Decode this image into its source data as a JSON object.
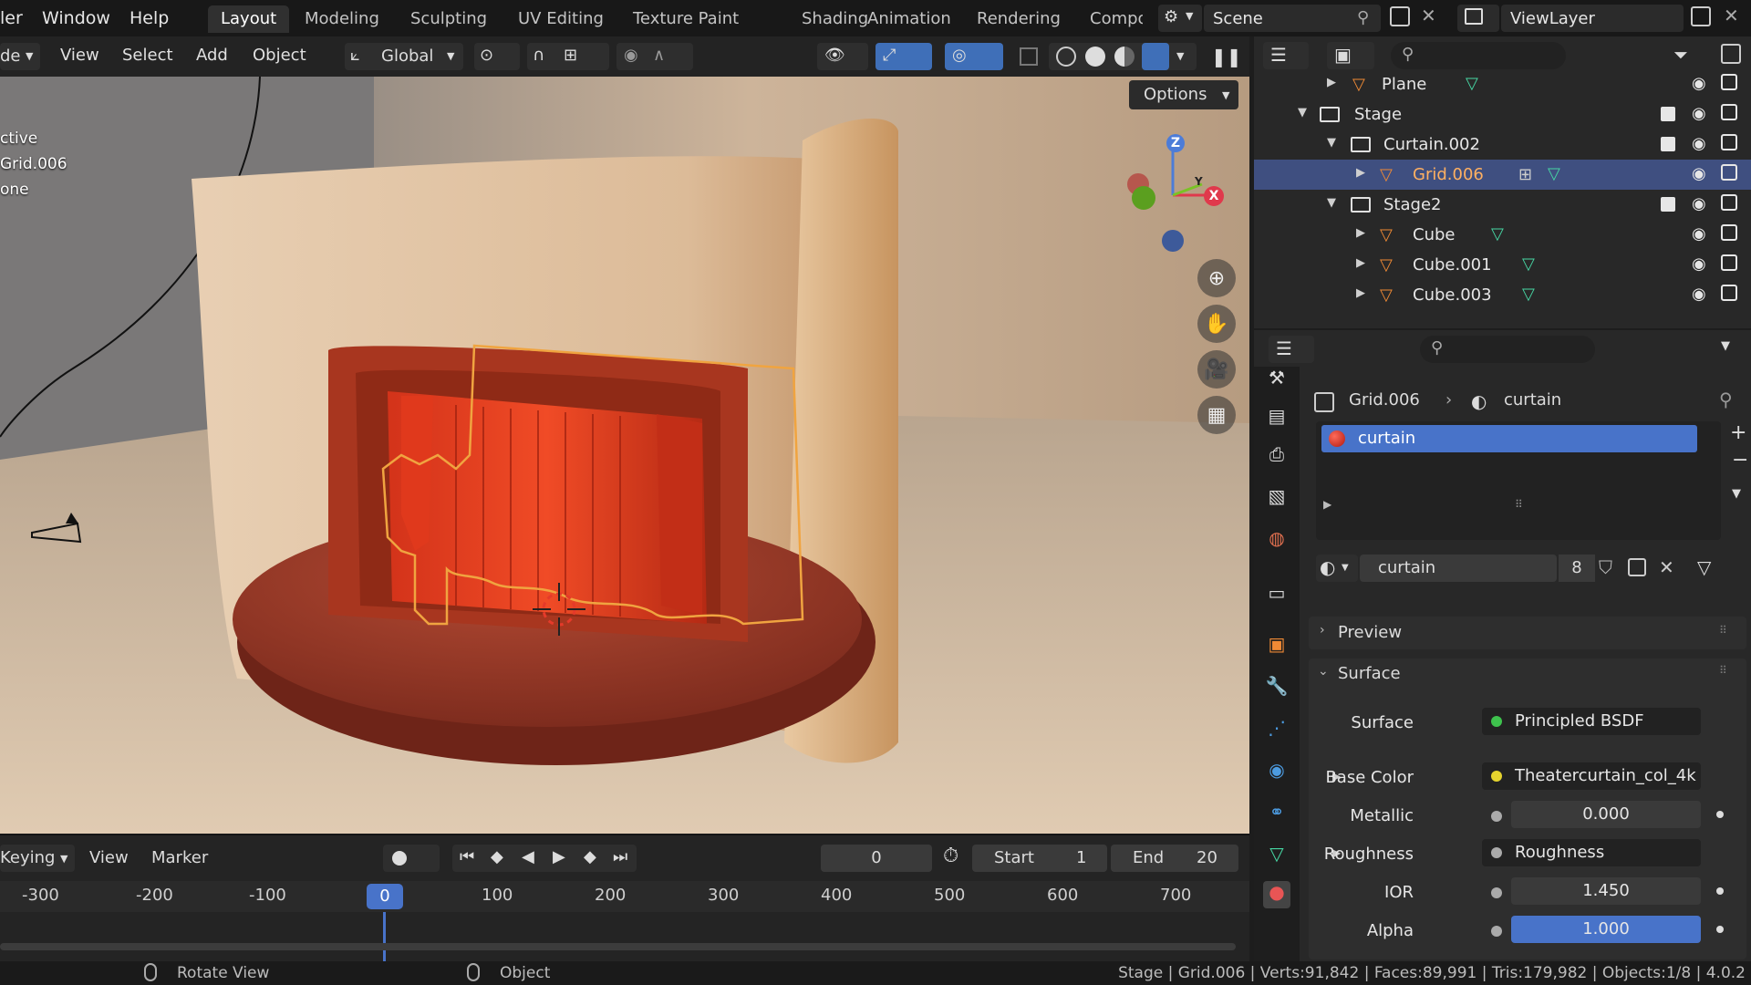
{
  "menus": {
    "file_partial": "ler",
    "window": "Window",
    "help": "Help"
  },
  "workspaces": [
    "Layout",
    "Modeling",
    "Sculpting",
    "UV Editing",
    "Texture Paint",
    "Shading",
    "Animation",
    "Rendering",
    "Compo"
  ],
  "scene": {
    "label": "Scene"
  },
  "view_layer": {
    "label": "ViewLayer"
  },
  "viewport_header": {
    "mode_partial": "de",
    "view": "View",
    "select": "Select",
    "add": "Add",
    "object": "Object",
    "transform_orientation": "Global"
  },
  "viewport": {
    "overlay_lines": [
      "ctive",
      "Grid.006",
      "one"
    ],
    "options_button": "Options",
    "gizmo_axes": {
      "z": "Z",
      "x": "X",
      "y": "Y"
    }
  },
  "timeline": {
    "keying_partial": "Keying",
    "view": "View",
    "marker": "Marker",
    "current_frame": "0",
    "start_label": "Start",
    "start_value": "1",
    "end_label": "End",
    "end_value": "20",
    "ruler": [
      "-300",
      "-200",
      "-100",
      "0",
      "100",
      "200",
      "300",
      "400",
      "500",
      "600",
      "700"
    ]
  },
  "outliner": {
    "rows": [
      {
        "name": "Plane"
      },
      {
        "name": "Stage"
      },
      {
        "name": "Curtain.002"
      },
      {
        "name": "Grid.006"
      },
      {
        "name": "Stage2"
      },
      {
        "name": "Cube"
      },
      {
        "name": "Cube.001"
      },
      {
        "name": "Cube.003"
      }
    ]
  },
  "properties": {
    "breadcrumb_object": "Grid.006",
    "breadcrumb_material": "curtain",
    "slot_name": "curtain",
    "material_name": "curtain",
    "user_count": "8",
    "preview_label": "Preview",
    "surface_section": "Surface",
    "fields": {
      "surface_label": "Surface",
      "surface_value": "Principled BSDF",
      "base_color_label": "Base Color",
      "base_color_value": "Theatercurtain_col_4k",
      "metallic_label": "Metallic",
      "metallic_value": "0.000",
      "roughness_label": "Roughness",
      "roughness_value": "Roughness",
      "ior_label": "IOR",
      "ior_value": "1.450",
      "alpha_label": "Alpha",
      "alpha_value": "1.000"
    }
  },
  "status_bar": {
    "rotate_view": "Rotate View",
    "object": "Object",
    "stats": "Stage | Grid.006 | Verts:91,842 | Faces:89,991 | Tris:179,982 | Objects:1/8 | 4.0.2"
  },
  "colors": {
    "accent_blue": "#4873c9",
    "selection_orange": "#ffb061",
    "mesh_icon": "#f08a35",
    "curtain_red": "#c0391b"
  }
}
